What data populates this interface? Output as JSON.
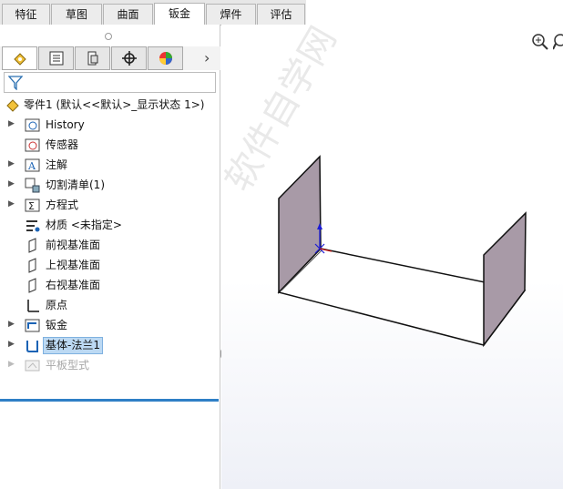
{
  "tabs": [
    {
      "label": "特征"
    },
    {
      "label": "草图"
    },
    {
      "label": "曲面"
    },
    {
      "label": "钣金",
      "active": true
    },
    {
      "label": "焊件"
    },
    {
      "label": "评估"
    }
  ],
  "panel_tabs": [
    {
      "icon": "feature-manager-icon",
      "active": true
    },
    {
      "icon": "property-manager-icon"
    },
    {
      "icon": "configuration-manager-icon"
    },
    {
      "icon": "dimxpert-icon"
    },
    {
      "icon": "display-manager-icon"
    }
  ],
  "tree": {
    "root": "零件1 (默认<<默认>_显示状态 1>)",
    "items": [
      {
        "label": "History",
        "icon": "history-icon",
        "expandable": true
      },
      {
        "label": "传感器",
        "icon": "sensor-icon",
        "expandable": false
      },
      {
        "label": "注解",
        "icon": "annotation-icon",
        "expandable": true
      },
      {
        "label": "切割清单(1)",
        "icon": "cut-list-icon",
        "expandable": true
      },
      {
        "label": "方程式",
        "icon": "equation-icon",
        "expandable": true
      },
      {
        "label": "材质 <未指定>",
        "icon": "material-icon",
        "expandable": false
      },
      {
        "label": "前视基准面",
        "icon": "plane-icon",
        "expandable": false
      },
      {
        "label": "上视基准面",
        "icon": "plane-icon",
        "expandable": false
      },
      {
        "label": "右视基准面",
        "icon": "plane-icon",
        "expandable": false
      },
      {
        "label": "原点",
        "icon": "origin-icon",
        "expandable": false
      },
      {
        "label": "钣金",
        "icon": "sheet-metal-icon",
        "expandable": true
      },
      {
        "label": "基体-法兰1",
        "icon": "base-flange-icon",
        "expandable": true,
        "selected": true
      },
      {
        "label": "平板型式",
        "icon": "flat-pattern-icon",
        "expandable": true,
        "disabled": true
      }
    ]
  },
  "watermark": "软件自学网",
  "colors": {
    "accent": "#2f7fc6",
    "selection": "#bcd9f3",
    "wall": "#a89aa7"
  }
}
